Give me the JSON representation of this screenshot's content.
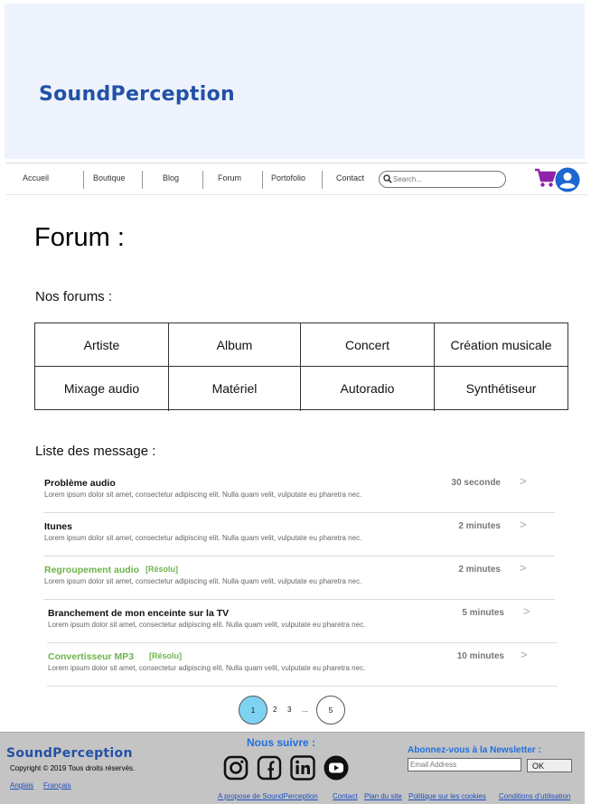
{
  "brand": {
    "name": "SoundPerception"
  },
  "nav": {
    "items": [
      "Accueil",
      "Boutique",
      "Blog",
      "Forum",
      "Portofolio",
      "Contact"
    ],
    "search_placeholder": "Search...",
    "cart_icon": "shopping-cart-icon",
    "user_icon": "account-circle-icon",
    "accent_color": "#8e24aa",
    "user_color": "#1e66d0"
  },
  "page": {
    "title": "Forum :",
    "forums_heading": "Nos forums :",
    "forums": [
      "Artiste",
      "Album",
      "Concert",
      "Création musicale",
      "Mixage audio",
      "Matériel",
      "Autoradio",
      "Synthétiseur"
    ],
    "messages_heading": "Liste des message :"
  },
  "messages": [
    {
      "title": "Problème audio",
      "resolved": "",
      "body": "Lorem ipsum dolor sit amet, consectetur adipiscing elit. Nulla quam velit, vulputate eu pharetra nec.",
      "time": "30 seconde",
      "arrow": ">"
    },
    {
      "title": "Itunes",
      "resolved": "",
      "body": "Lorem ipsum dolor sit amet, consectetur adipiscing elit. Nulla quam velit, vulputate eu pharetra nec.",
      "time": "2 minutes",
      "arrow": ">"
    },
    {
      "title": "Regroupement audio",
      "resolved": "[Résolu]",
      "body": "Lorem ipsum dolor sit amet, consectetur adipiscing elit. Nulla quam velit, vulputate eu pharetra nec.",
      "time": "2 minutes",
      "arrow": ">"
    },
    {
      "title": "Branchement de mon enceinte sur la TV",
      "resolved": "",
      "body": "Lorem ipsum dolor sit amet, consectetur adipiscing elit. Nulla quam velit, vulputate eu pharetra nec.",
      "time": "5 minutes",
      "arrow": ">"
    },
    {
      "title": "Convertisseur MP3",
      "resolved": "[Résolu]",
      "body": "Lorem ipsum dolor sit amet, consectetur adipiscing elit. Nulla quam velit, vulputate eu pharetra nec.",
      "time": "10 minutes",
      "arrow": ">"
    }
  ],
  "pagination": {
    "current": "1",
    "p2": "2",
    "p3": "3",
    "ellipsis": "...",
    "last": "5",
    "active_color": "#7fd3f2"
  },
  "footer": {
    "brand": "SoundPerception",
    "copyright": "Copyright © 2019 Tous droits réservés.",
    "lang_en": "Anglais",
    "lang_fr": "Français",
    "follow": "Nous suivre :",
    "social_icons": [
      "instagram-icon",
      "facebook-icon",
      "linkedin-icon",
      "youtube-icon"
    ],
    "newsletter_title": "Abonnez-vous à la Newsletter :",
    "email_placeholder": "Email Address",
    "ok": "OK",
    "links": [
      "A propose de SoundPerception",
      "Contact",
      "Plan du site",
      "Politique sur les cookies",
      "Conditions d'utilisation"
    ]
  }
}
